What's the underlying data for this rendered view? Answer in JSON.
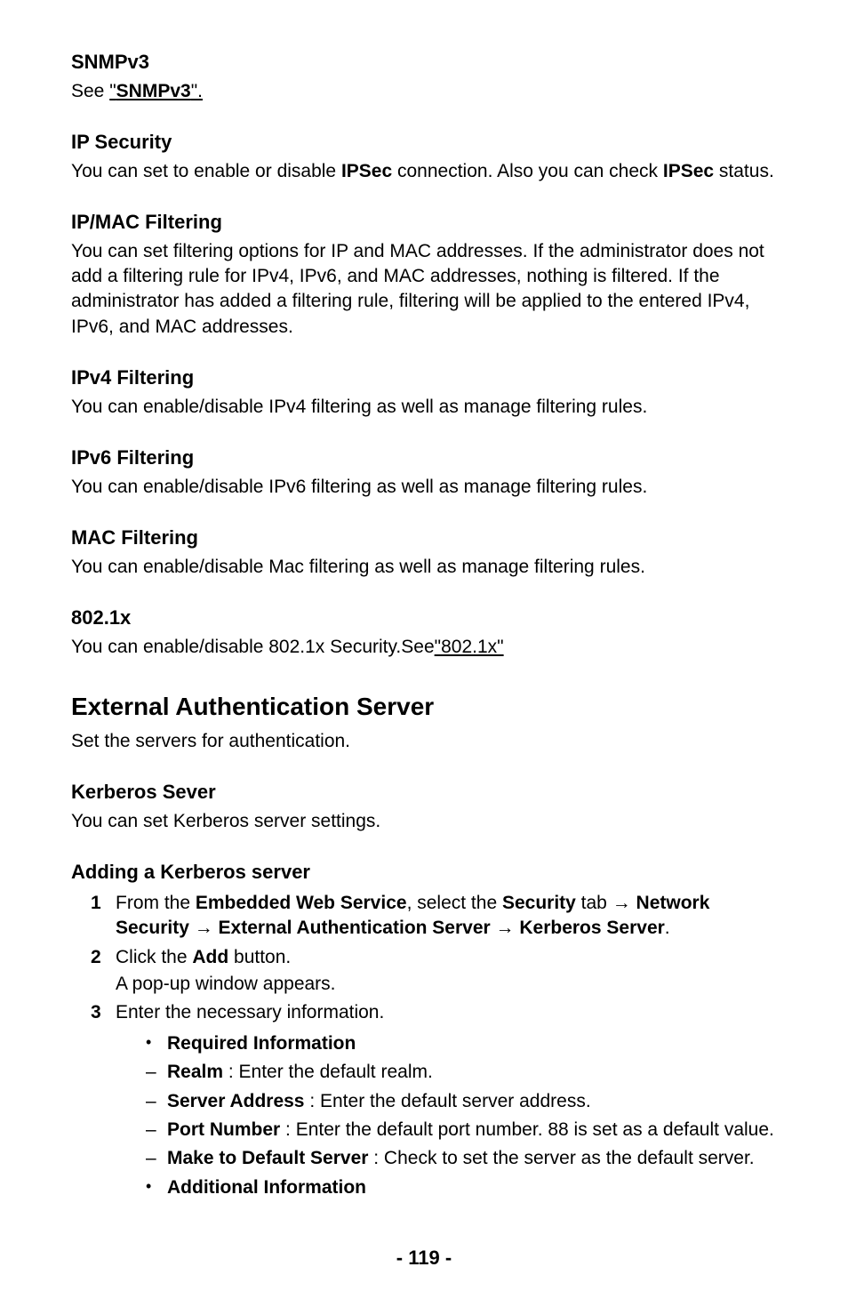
{
  "sections": {
    "snmpv3": {
      "heading": "SNMPv3",
      "see_prefix": "See ",
      "link_open_quote": "\"",
      "link_text": "SNMPv3",
      "link_close_quote": "\"."
    },
    "ipsecurity": {
      "heading": "IP Security",
      "body_a": "You can set to enable or disable ",
      "body_b_bold": "IPSec",
      "body_c": " connection. Also you can check ",
      "body_d_bold": "IPSec",
      "body_e": " status."
    },
    "ipmac": {
      "heading": "IP/MAC Filtering",
      "body": "You can set filtering options for IP and MAC addresses. If the administrator does not add a filtering rule for IPv4, IPv6, and MAC addresses, nothing is filtered. If the administrator has added a filtering rule, filtering will be applied to the entered IPv4, IPv6, and MAC addresses."
    },
    "ipv4": {
      "heading": "IPv4 Filtering",
      "body": "You can enable/disable IPv4 filtering as well as manage filtering rules."
    },
    "ipv6": {
      "heading": "IPv6 Filtering",
      "body": "You can enable/disable IPv6 filtering as well as manage filtering rules."
    },
    "mac": {
      "heading": "MAC Filtering",
      "body": "You can enable/disable Mac filtering as well as manage filtering rules."
    },
    "dot1x": {
      "heading": "802.1x",
      "body_a": "You can enable/disable 802.1x Security.See",
      "link_text": "\"802.1x\""
    },
    "extauth": {
      "heading": "External Authentication Server",
      "body": "Set the servers for authentication."
    },
    "kerberos": {
      "heading": "Kerberos Sever",
      "body": "You can set Kerberos server settings."
    },
    "add_kerberos": {
      "heading": "Adding a Kerberos server",
      "steps": {
        "1": {
          "num": "1",
          "a": "From the ",
          "b_bold": "Embedded Web Service",
          "c": ", select the ",
          "d_bold": "Security",
          "e": " tab ",
          "arrow1": "→",
          "f_bold": " Network Security ",
          "arrow2": "→",
          "g_bold": " External Authentication Server ",
          "arrow3": "→",
          "h_bold": " Kerberos Server",
          "i": "."
        },
        "2": {
          "num": "2",
          "a": "Click the ",
          "b_bold": "Add",
          "c": " button.",
          "sub": "A pop-up window appears."
        },
        "3": {
          "num": "3",
          "a": "Enter the necessary information."
        }
      },
      "bullets": {
        "req_info": "Required Information",
        "realm_label": "Realm",
        "realm_body": " : Enter the default realm.",
        "server_addr_label": "Server Address",
        "server_addr_body": " : Enter the default server address.",
        "port_label": "Port Number",
        "port_body": " : Enter the default port number. 88 is set as a default value.",
        "default_label": "Make to Default Server",
        "default_body": " : Check to set the server as the default server.",
        "addl_info": "Additional Information"
      }
    }
  },
  "footer": {
    "prefix": "- ",
    "page": "119",
    "suffix": " -"
  }
}
